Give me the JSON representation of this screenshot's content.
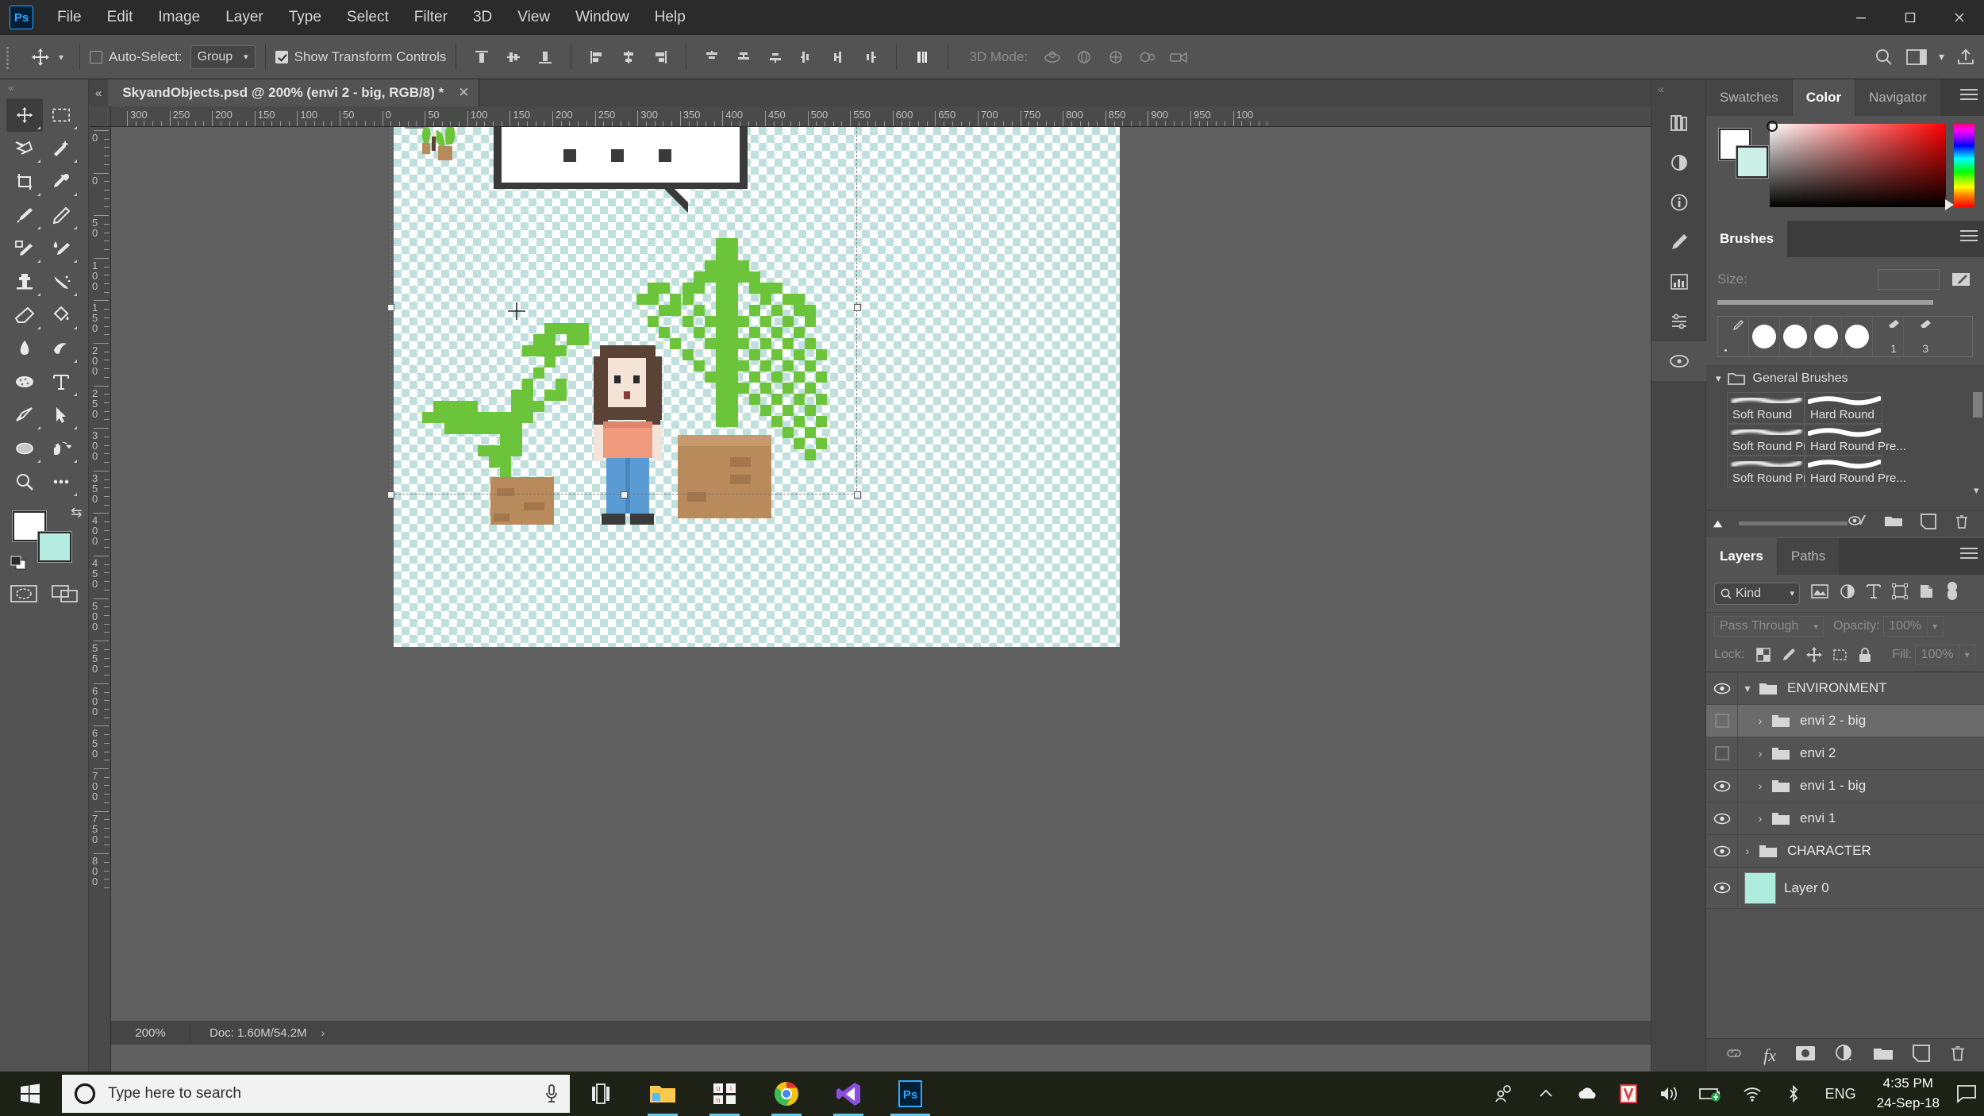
{
  "app": {
    "logo": "Ps",
    "menus": [
      "File",
      "Edit",
      "Image",
      "Layer",
      "Type",
      "Select",
      "Filter",
      "3D",
      "View",
      "Window",
      "Help"
    ],
    "window_controls": {
      "minimize": "—",
      "maximize": "❐",
      "close": "✕"
    }
  },
  "options_bar": {
    "tool_icon": "move-tool-icon",
    "auto_select_label": "Auto-Select:",
    "auto_select_checked": false,
    "group_value": "Group",
    "show_transform_label": "Show Transform Controls",
    "show_transform_checked": true,
    "mode_3d_label": "3D Mode:",
    "align_icons": [
      "align-top-edges",
      "align-vertical-centers",
      "align-bottom-edges",
      "align-left-edges",
      "align-horizontal-centers",
      "align-right-edges"
    ],
    "distribute_icons": [
      "distribute-top-edges",
      "distribute-vertical-centers",
      "distribute-bottom-edges",
      "distribute-left-edges",
      "distribute-horizontal-centers",
      "distribute-right-edges"
    ],
    "extra_icon": "align-distribute-panel",
    "mode_3d_icons": [
      "orbit-3d-icon",
      "roll-3d-icon",
      "pan-3d-icon",
      "slide-3d-icon",
      "camera-3d-icon"
    ],
    "right_icons": [
      "search-icon",
      "workspace-icon",
      "chevron-down-icon",
      "share-icon"
    ]
  },
  "toolbar": {
    "tools": [
      {
        "name": "move-tool",
        "glyph": "move",
        "selected": true,
        "flyout": true
      },
      {
        "name": "rectangular-marquee-tool",
        "glyph": "marquee",
        "selected": false,
        "flyout": true
      },
      {
        "name": "lasso-tool",
        "glyph": "lasso",
        "selected": false,
        "flyout": true
      },
      {
        "name": "object-selection-tool",
        "glyph": "magicwand",
        "selected": false,
        "flyout": true
      },
      {
        "name": "crop-tool",
        "glyph": "crop",
        "selected": false,
        "flyout": true
      },
      {
        "name": "eyedropper-tool",
        "glyph": "eyedropper",
        "selected": false,
        "flyout": true
      },
      {
        "name": "spot-healing-brush-tool",
        "glyph": "brush",
        "selected": false,
        "flyout": true
      },
      {
        "name": "pencil-tool",
        "glyph": "pencil",
        "selected": false,
        "flyout": true
      },
      {
        "name": "mixer-brush-tool",
        "glyph": "mixerbrush",
        "selected": false,
        "flyout": true
      },
      {
        "name": "healing-brush-tool",
        "glyph": "healbrush",
        "selected": false,
        "flyout": true
      },
      {
        "name": "clone-stamp-tool",
        "glyph": "stamp",
        "selected": false,
        "flyout": true
      },
      {
        "name": "history-brush-tool",
        "glyph": "historybrush",
        "selected": false,
        "flyout": true
      },
      {
        "name": "eraser-tool",
        "glyph": "eraser",
        "selected": false,
        "flyout": true
      },
      {
        "name": "paint-bucket-tool",
        "glyph": "bucket",
        "selected": false,
        "flyout": true
      },
      {
        "name": "blur-tool",
        "glyph": "blur",
        "selected": false,
        "flyout": false
      },
      {
        "name": "dodge-tool",
        "glyph": "dodge",
        "selected": false,
        "flyout": true
      },
      {
        "name": "sponge-tool",
        "glyph": "sponge",
        "selected": false,
        "flyout": true
      },
      {
        "name": "horizontal-type-tool",
        "glyph": "type",
        "selected": false,
        "flyout": true
      },
      {
        "name": "pen-tool",
        "glyph": "pen",
        "selected": false,
        "flyout": true
      },
      {
        "name": "path-selection-tool",
        "glyph": "arrow",
        "selected": false,
        "flyout": true
      },
      {
        "name": "ellipse-tool",
        "glyph": "ellipse",
        "selected": false,
        "flyout": true
      },
      {
        "name": "rotate-view-tool",
        "glyph": "hand",
        "selected": false,
        "flyout": true
      },
      {
        "name": "zoom-tool",
        "glyph": "zoom",
        "selected": false,
        "flyout": false
      },
      {
        "name": "edit-toolbar",
        "glyph": "dots",
        "selected": false,
        "flyout": true
      }
    ],
    "foreground_color": "#ffffff",
    "background_color": "#b5ece1",
    "quick_mask": "edit-in-quick-mask-mode",
    "screen_mode": "change-screen-mode"
  },
  "document": {
    "tab_title": "SkyandObjects.psd @ 200% (envi 2 - big, RGB/8) *",
    "close_glyph": "✕",
    "zoom": "200%",
    "doc_size": "Doc: 1.60M/54.2M",
    "status_arrow": "›",
    "ruler_h_labels": [
      "300",
      "250",
      "200",
      "150",
      "100",
      "50",
      "0",
      "50",
      "100",
      "150",
      "200",
      "250",
      "300",
      "350",
      "400",
      "450",
      "500",
      "550",
      "600",
      "650",
      "700",
      "750",
      "800",
      "850",
      "900",
      "950",
      "100"
    ],
    "ruler_v_labels": [
      "0",
      "0",
      "50",
      "100",
      "150",
      "200",
      "250",
      "300",
      "350",
      "400",
      "450",
      "500",
      "550",
      "600",
      "650",
      "700",
      "750",
      "800"
    ]
  },
  "rail_icons": [
    "libraries-icon",
    "adjustments-icon",
    "info-icon",
    "brush-settings-icon",
    "histogram-icon",
    "properties-icon",
    "paths-icon"
  ],
  "color_panel": {
    "tabs": [
      {
        "label": "Swatches",
        "active": false
      },
      {
        "label": "Color",
        "active": true
      },
      {
        "label": "Navigator",
        "active": false
      }
    ],
    "menu": "panel-menu-icon",
    "foreground": "#ffffff",
    "background": "#ccf0e6",
    "hue_selected": "#ff0000"
  },
  "brushes_panel": {
    "tabs": [
      {
        "label": "Brushes",
        "active": true
      }
    ],
    "menu": "panel-menu-icon",
    "size_label": "Size:",
    "size_value": "",
    "numbered_cells": [
      "1",
      "3"
    ],
    "group_label": "General Brushes",
    "presets": [
      {
        "name": "Soft Round",
        "type": "soft"
      },
      {
        "name": "Hard Round",
        "type": "hard"
      },
      {
        "name": "Soft Round Pres...",
        "type": "soft"
      },
      {
        "name": "Hard Round Pre...",
        "type": "hard"
      },
      {
        "name": "Soft Round Pres...",
        "type": "soft"
      },
      {
        "name": "Hard Round Pre...",
        "type": "hard"
      }
    ],
    "footer_icons": [
      "toggle-brush-preview-icon",
      "new-group-icon",
      "new-brush-icon",
      "delete-brush-icon"
    ]
  },
  "layers_panel": {
    "tabs": [
      {
        "label": "Layers",
        "active": true
      },
      {
        "label": "Paths",
        "active": false
      }
    ],
    "menu": "panel-menu-icon",
    "filter_label": "Kind",
    "filter_icons": [
      "filter-pixel-icon",
      "filter-adjustment-icon",
      "filter-type-icon",
      "filter-shape-icon",
      "filter-smart-object-icon",
      "filter-toggle-icon"
    ],
    "blend_mode": "Pass Through",
    "opacity_label": "Opacity:",
    "opacity_value": "100%",
    "lock_label": "Lock:",
    "lock_icons": [
      "lock-transparent-pixels-icon",
      "lock-image-pixels-icon",
      "lock-position-icon",
      "lock-artboard-icon",
      "lock-all-icon"
    ],
    "fill_label": "Fill:",
    "fill_value": "100%",
    "layers": [
      {
        "name": "ENVIRONMENT",
        "visible": true,
        "type": "group",
        "expanded": true,
        "indent": 0,
        "selected": false
      },
      {
        "name": "envi 2 - big",
        "visible": false,
        "type": "group",
        "expanded": false,
        "indent": 1,
        "selected": true
      },
      {
        "name": "envi 2",
        "visible": false,
        "type": "group",
        "expanded": false,
        "indent": 1,
        "selected": false
      },
      {
        "name": "envi 1 - big",
        "visible": true,
        "type": "group",
        "expanded": false,
        "indent": 1,
        "selected": false
      },
      {
        "name": "envi 1",
        "visible": true,
        "type": "group",
        "expanded": false,
        "indent": 1,
        "selected": false
      },
      {
        "name": "CHARACTER",
        "visible": true,
        "type": "group",
        "expanded": false,
        "indent": 0,
        "selected": false
      },
      {
        "name": "Layer 0",
        "visible": true,
        "type": "layer",
        "indent": 0,
        "selected": false,
        "thumb_color": "#aeecdd"
      }
    ],
    "footer_icons": [
      "link-layers-icon",
      "layer-style-icon",
      "layer-mask-icon",
      "new-fill-adjustment-icon",
      "new-group-icon",
      "new-layer-icon",
      "delete-layer-icon"
    ],
    "footer_fx_label": "fx"
  },
  "canvas": {
    "background_checker_color": "#bfe0dd",
    "speech_bubble_dots": 3,
    "plant_color": "#6cc43a",
    "pot_color": "#b98a5b",
    "character_hair": "#5a4237",
    "character_skin": "#f4e3d7",
    "character_shirt": "#f09a7e",
    "character_pants": "#5b9bd5"
  },
  "taskbar": {
    "start": "windows-start-icon",
    "search_placeholder": "Type here to search",
    "cortana": "cortana-circle-icon",
    "mic": "microphone-icon",
    "task_view": "task-view-icon",
    "apps": [
      {
        "name": "file-explorer",
        "open": true
      },
      {
        "name": "unity-hub",
        "open": true
      },
      {
        "name": "google-chrome",
        "open": true
      },
      {
        "name": "visual-studio-code",
        "open": true
      },
      {
        "name": "adobe-photoshop",
        "open": true,
        "active": true
      }
    ],
    "tray_icons": [
      "people-icon",
      "show-hidden-icons-chevron",
      "onedrive-icon",
      "antivirus-icon",
      "volume-icon",
      "battery-icon",
      "network-wifi-icon",
      "bluetooth-icon"
    ],
    "language": "ENG",
    "time": "4:35 PM",
    "date": "24-Sep-18",
    "notifications": "action-center-icon"
  }
}
